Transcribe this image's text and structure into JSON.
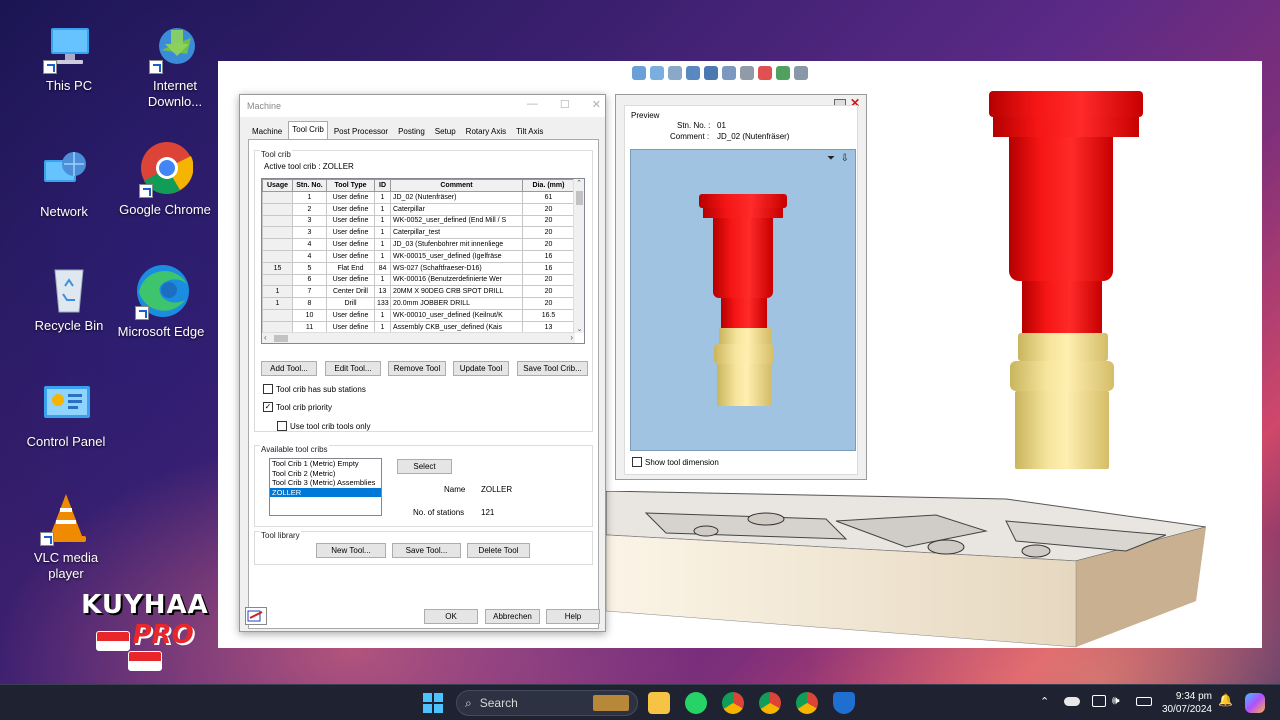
{
  "desktop": {
    "icons": [
      {
        "label": "This PC"
      },
      {
        "label": "Internet Downlo..."
      },
      {
        "label": "Network"
      },
      {
        "label": "Google Chrome"
      },
      {
        "label": "Recycle Bin"
      },
      {
        "label": "Microsoft Edge"
      },
      {
        "label": "Control Panel"
      },
      {
        "label": "VLC media player"
      }
    ],
    "watermark": {
      "line1": "KUYHAA",
      "line2": "PRO"
    }
  },
  "machine_dialog": {
    "title": "Machine",
    "tabs": [
      "Machine",
      "Tool Crib",
      "Post Processor",
      "Posting",
      "Setup",
      "Rotary Axis",
      "Tilt Axis"
    ],
    "active_tab": "Tool Crib",
    "tool_crib_group": "Tool crib",
    "active_tool_crib_label": "Active tool crib :",
    "active_tool_crib_value": "ZOLLER",
    "table": {
      "headers": [
        "Usage",
        "Stn. No.",
        "Tool Type",
        "ID",
        "Comment",
        "Dia. (mm)"
      ],
      "rows": [
        [
          "",
          "1",
          "User define",
          "1",
          "JD_02 (Nutenfräser)",
          "61"
        ],
        [
          "",
          "2",
          "User define",
          "1",
          "Caterpillar",
          "20"
        ],
        [
          "",
          "3",
          "User define",
          "1",
          "WK-0052_user_defined (End Mill / S",
          "20"
        ],
        [
          "",
          "3",
          "User define",
          "1",
          "Caterpillar_test",
          "20"
        ],
        [
          "",
          "4",
          "User define",
          "1",
          "JD_03 (Stufenbohrer mit innenliege",
          "20"
        ],
        [
          "",
          "4",
          "User define",
          "1",
          "WK-00015_user_defined (Igelfräse",
          "16"
        ],
        [
          "15",
          "5",
          "Flat End",
          "84",
          "WS-027 (Schaftfraeser-D16)",
          "16"
        ],
        [
          "",
          "6",
          "User define",
          "1",
          "WK-00016 (Benutzerdefinierte Wer",
          "20"
        ],
        [
          "1",
          "7",
          "Center Drill",
          "13",
          "20MM X 90DEG CRB SPOT DRILL",
          "20"
        ],
        [
          "1",
          "8",
          "Drill",
          "133",
          "20.0mm JOBBER DRILL",
          "20"
        ],
        [
          "",
          "10",
          "User define",
          "1",
          "WK-00010_user_defined (Keilnut/K",
          "16.5"
        ],
        [
          "",
          "11",
          "User define",
          "1",
          "Assembly CKB_user_defined (Kais",
          "13"
        ]
      ]
    },
    "buttons": {
      "add_tool": "Add Tool...",
      "edit_tool": "Edit Tool...",
      "remove_tool": "Remove Tool",
      "update_tool": "Update Tool",
      "save_tool_crib": "Save Tool Crib..."
    },
    "checks": {
      "sub_stations": {
        "label": "Tool crib has sub stations",
        "checked": false
      },
      "priority": {
        "label": "Tool crib priority",
        "checked": true
      },
      "use_only": {
        "label": "Use tool crib tools only",
        "checked": false
      }
    },
    "available_group": "Available tool cribs",
    "available_list": [
      "Tool Crib 1 (Metric) Empty",
      "Tool Crib 2 (Metric)",
      "Tool Crib 3 (Metric) Assemblies",
      "ZOLLER"
    ],
    "selected_crib": "ZOLLER",
    "select_button": "Select",
    "name_label": "Name",
    "name_value": "ZOLLER",
    "stations_label": "No. of stations",
    "stations_value": "121",
    "library_group": "Tool library",
    "library_buttons": {
      "new_tool": "New Tool...",
      "save_tool": "Save Tool...",
      "delete_tool": "Delete Tool"
    },
    "footer": {
      "ok": "OK",
      "cancel": "Abbrechen",
      "help": "Help"
    }
  },
  "preview": {
    "group": "Preview",
    "stn_label": "Stn. No. :",
    "stn_value": "01",
    "comment_label": "Comment :",
    "comment_value": "JD_02 (Nutenfräser)",
    "show_dimension": "Show tool dimension",
    "bg_color": "#9fc3e1"
  },
  "taskbar": {
    "search_placeholder": "Search",
    "time": "9:34 pm",
    "date": "30/07/2024"
  },
  "colors": {
    "tool_red": "#ff1a1a",
    "tool_gold": "#f3e09a",
    "selection": "#0078d7"
  }
}
